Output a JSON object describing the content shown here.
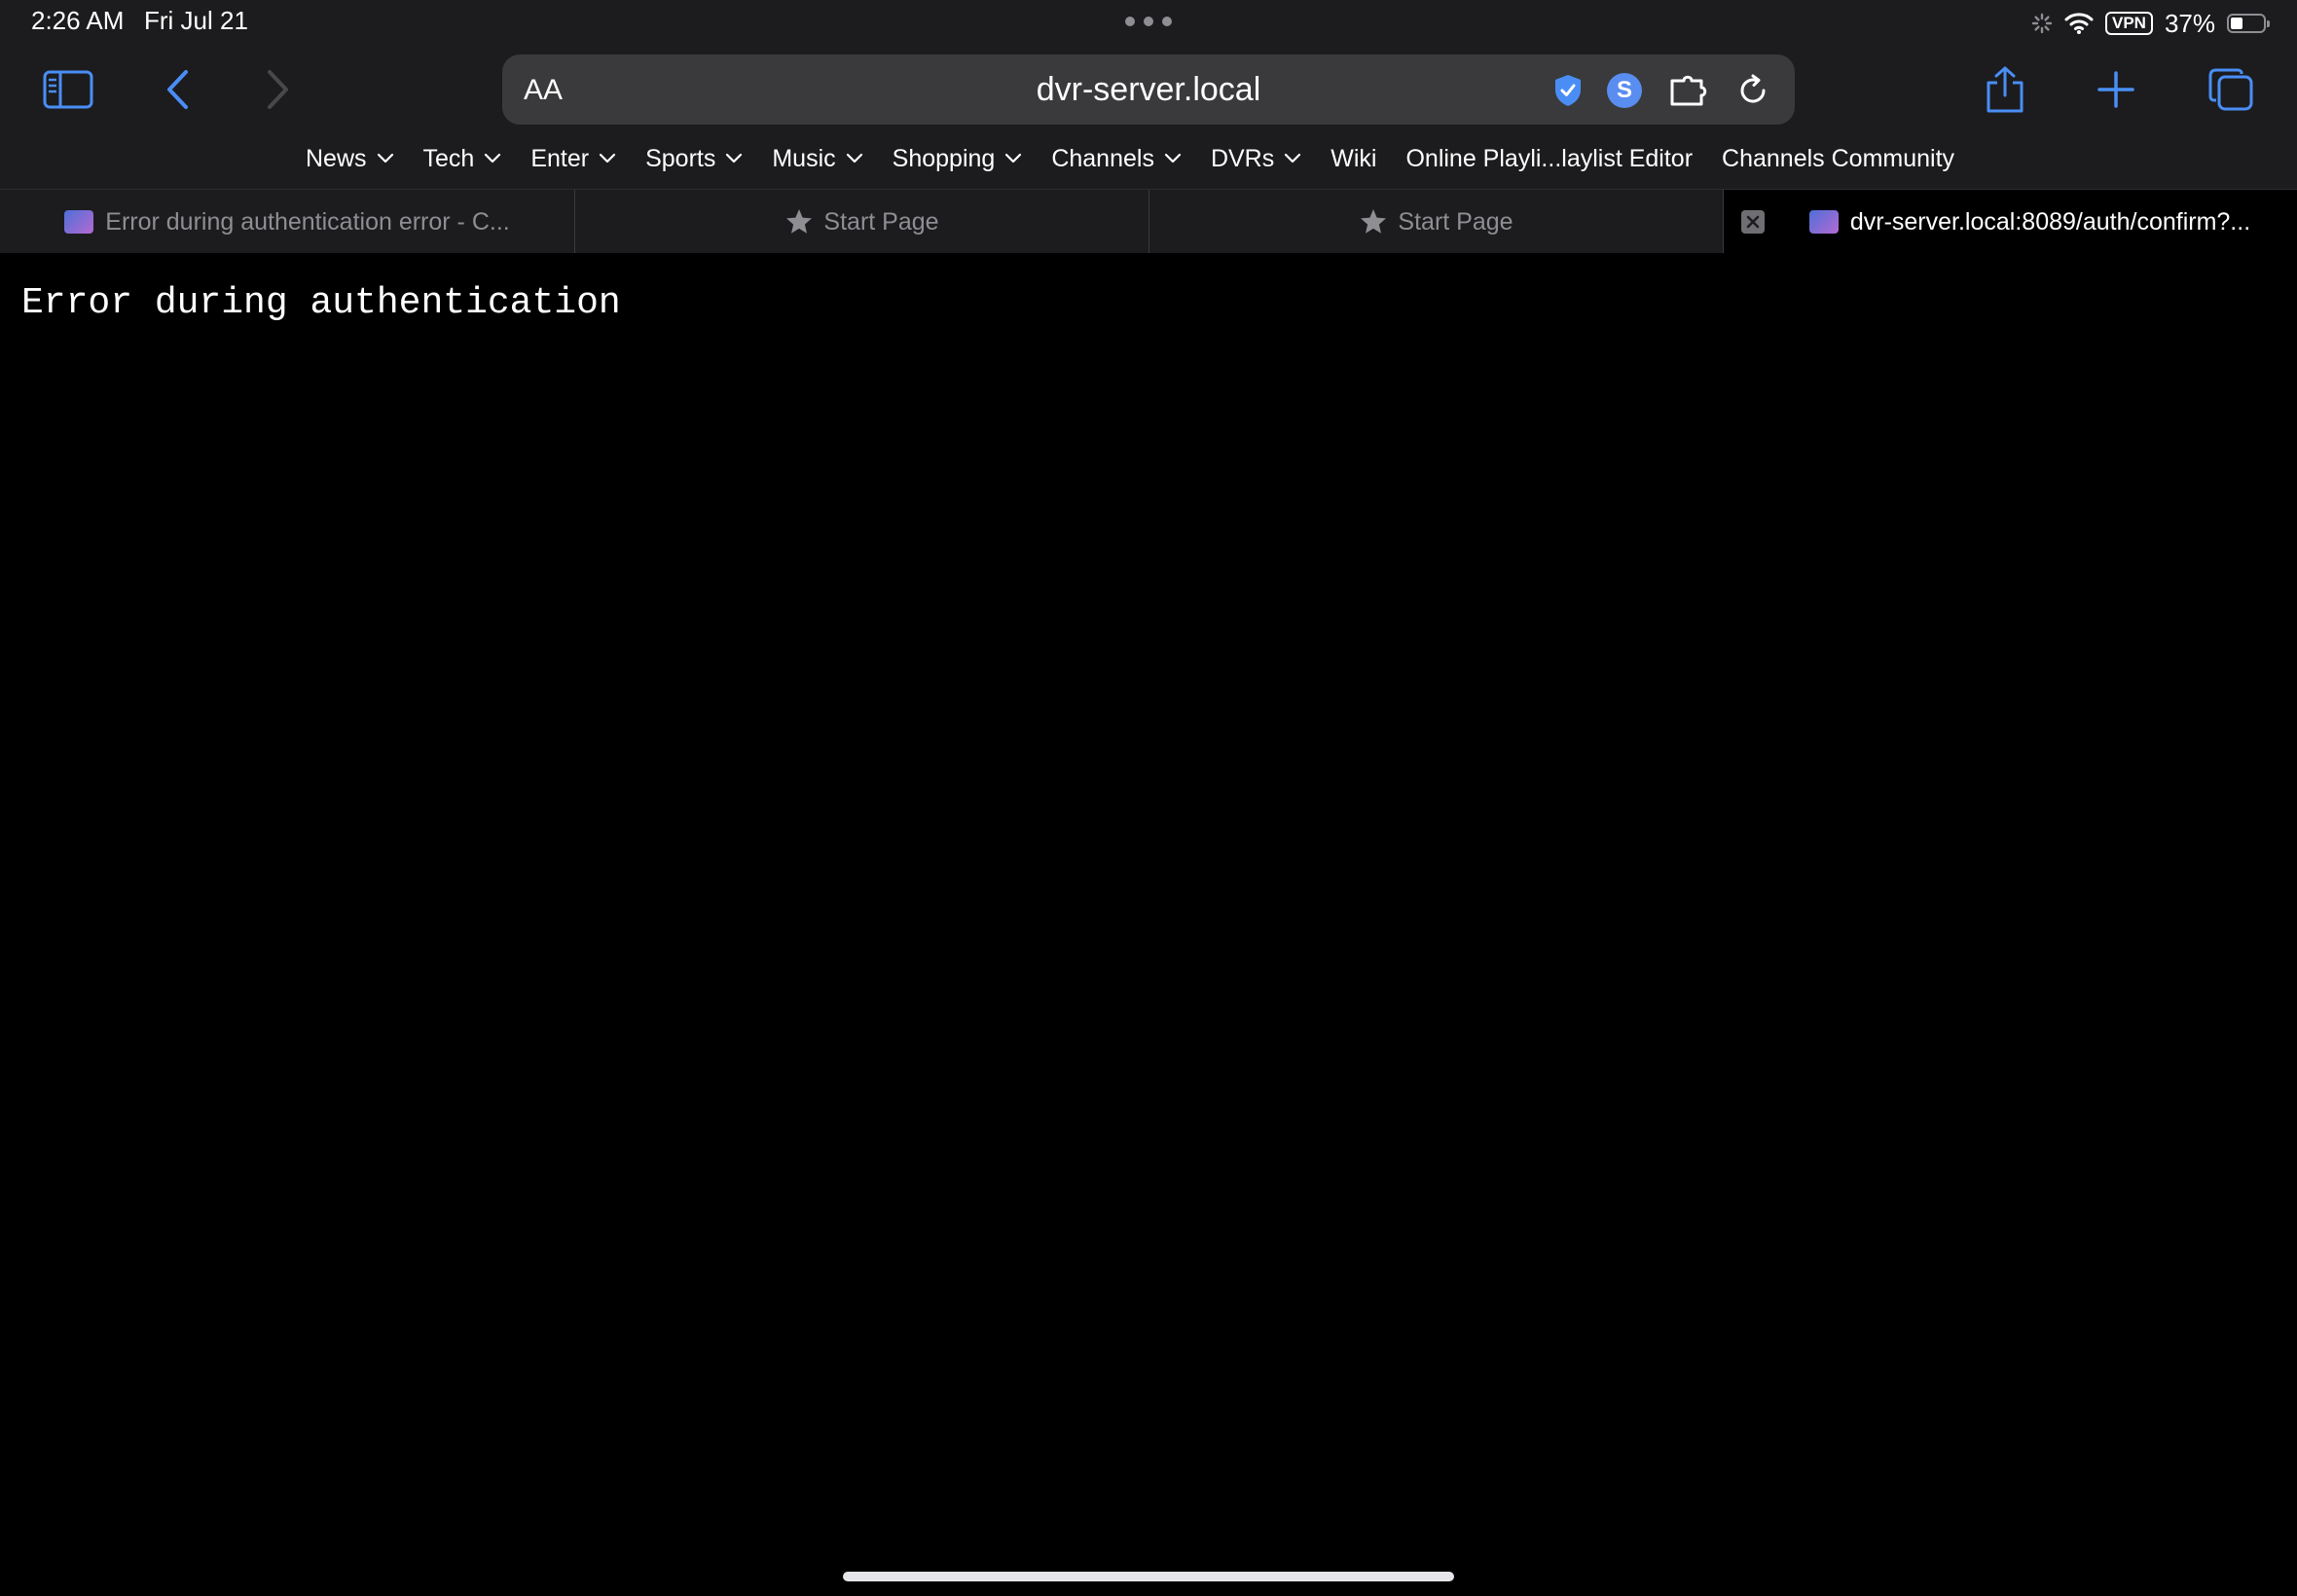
{
  "status_bar": {
    "time": "2:26 AM",
    "date": "Fri Jul 21",
    "vpn": "VPN",
    "battery_percent": "37%",
    "battery_level": 0.37
  },
  "toolbar": {
    "icons": [
      "sidebar-icon",
      "back-icon",
      "forward-icon",
      "share-icon",
      "plus-icon",
      "tabs-icon"
    ]
  },
  "address_bar": {
    "text_size_label": "AA",
    "url": "dvr-server.local",
    "icons": [
      "shield-icon",
      "s-extension-icon",
      "extension-icon",
      "reload-icon"
    ]
  },
  "favorites": [
    {
      "label": "News",
      "has_menu": true
    },
    {
      "label": "Tech",
      "has_menu": true
    },
    {
      "label": "Enter",
      "has_menu": true
    },
    {
      "label": "Sports",
      "has_menu": true
    },
    {
      "label": "Music",
      "has_menu": true
    },
    {
      "label": "Shopping",
      "has_menu": true
    },
    {
      "label": "Channels",
      "has_menu": true
    },
    {
      "label": "DVRs",
      "has_menu": true
    },
    {
      "label": "Wiki",
      "has_menu": false
    },
    {
      "label": "Online Playli...laylist Editor",
      "has_menu": false
    },
    {
      "label": "Channels Community",
      "has_menu": false
    }
  ],
  "tabs": [
    {
      "title": "Error during authentication error - C...",
      "icon": "favicon",
      "active": false
    },
    {
      "title": "Start Page",
      "icon": "star-icon",
      "active": false
    },
    {
      "title": "Start Page",
      "icon": "star-icon",
      "active": false
    },
    {
      "title": "dvr-server.local:8089/auth/confirm?...",
      "icon": "favicon",
      "active": true
    }
  ],
  "page": {
    "message": "Error during authentication"
  },
  "colors": {
    "chrome": "#1c1c1e",
    "address_field": "#3a3a3c",
    "accent": "#5a8df0",
    "page_background": "#000000"
  }
}
